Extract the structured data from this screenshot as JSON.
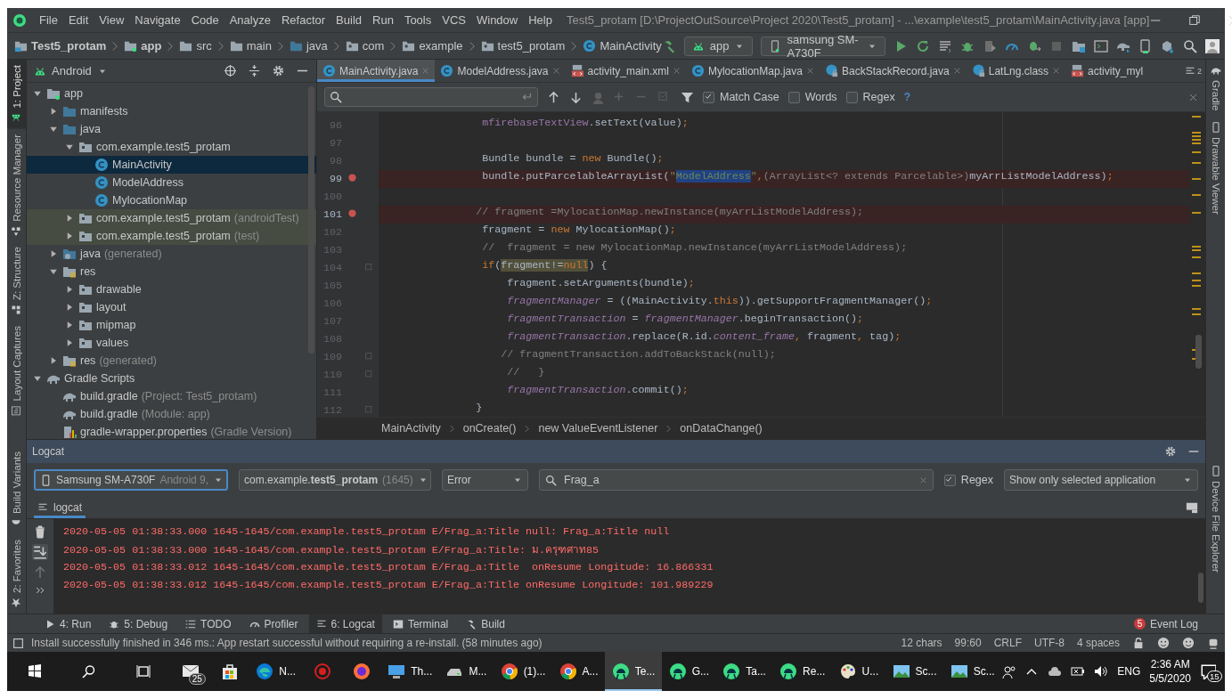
{
  "window": {
    "title": "Test5_protam [D:\\ProjectOutSource\\Project 2020\\Test5_protam] - ...\\example\\test5_protam\\MainActivity.java [app]",
    "menu": [
      "File",
      "Edit",
      "View",
      "Navigate",
      "Code",
      "Analyze",
      "Refactor",
      "Build",
      "Run",
      "Tools",
      "VCS",
      "Window",
      "Help"
    ]
  },
  "navigation": {
    "breadcrumbs": [
      {
        "label": "Test5_protam",
        "kind": "project"
      },
      {
        "label": "app",
        "kind": "module"
      },
      {
        "label": "src",
        "kind": "folder"
      },
      {
        "label": "main",
        "kind": "folder"
      },
      {
        "label": "java",
        "kind": "source"
      },
      {
        "label": "com",
        "kind": "package"
      },
      {
        "label": "example",
        "kind": "package"
      },
      {
        "label": "test5_protam",
        "kind": "package"
      },
      {
        "label": "MainActivity",
        "kind": "class"
      }
    ],
    "run_config": "app",
    "device": "samsung SM-A730F"
  },
  "left_stripe": [
    {
      "label": "1: Project",
      "selected": true
    },
    {
      "label": "Resource Manager",
      "selected": false
    },
    {
      "label": "Z: Structure",
      "selected": false
    },
    {
      "label": "Layout Captures",
      "selected": false
    },
    {
      "label": "Build Variants",
      "selected": false
    },
    {
      "label": "2: Favorites",
      "selected": false
    }
  ],
  "right_stripe": [
    "Gradle",
    "Drawable Viewer",
    "Device File Explorer"
  ],
  "project": {
    "view": "Android",
    "tree": [
      {
        "label": "app",
        "kind": "module",
        "expanded": true,
        "selected": false,
        "highlighted": false,
        "children": [
          {
            "label": "manifests",
            "kind": "source",
            "expanded": false,
            "selected": false,
            "highlighted": false
          },
          {
            "label": "java",
            "kind": "source",
            "expanded": true,
            "selected": false,
            "highlighted": false,
            "children": [
              {
                "label": "com.example.test5_protam",
                "kind": "package",
                "expanded": true,
                "selected": false,
                "highlighted": false,
                "children": [
                  {
                    "label": "MainActivity",
                    "kind": "class",
                    "selected": true,
                    "highlighted": false
                  },
                  {
                    "label": "ModelAddress",
                    "kind": "class",
                    "selected": false,
                    "highlighted": false
                  },
                  {
                    "label": "MylocationMap",
                    "kind": "class",
                    "selected": false,
                    "highlighted": false
                  }
                ]
              },
              {
                "label": "com.example.test5_protam",
                "note": "(androidTest)",
                "kind": "package",
                "expanded": false,
                "selected": false,
                "highlighted": true
              },
              {
                "label": "com.example.test5_protam",
                "note": "(test)",
                "kind": "package",
                "expanded": false,
                "selected": false,
                "highlighted": true
              }
            ]
          },
          {
            "label": "java",
            "note": "(generated)",
            "kind": "generated",
            "expanded": false,
            "selected": false,
            "highlighted": false
          },
          {
            "label": "res",
            "kind": "resources",
            "expanded": true,
            "selected": false,
            "highlighted": false,
            "children": [
              {
                "label": "drawable",
                "kind": "package",
                "expanded": false,
                "selected": false,
                "highlighted": false
              },
              {
                "label": "layout",
                "kind": "package",
                "expanded": false,
                "selected": false,
                "highlighted": false
              },
              {
                "label": "mipmap",
                "kind": "package",
                "expanded": false,
                "selected": false,
                "highlighted": false
              },
              {
                "label": "values",
                "kind": "package",
                "expanded": false,
                "selected": false,
                "highlighted": false
              }
            ]
          },
          {
            "label": "res",
            "note": "(generated)",
            "kind": "resources",
            "expanded": false,
            "selected": false,
            "highlighted": false
          }
        ]
      },
      {
        "label": "Gradle Scripts",
        "kind": "gradle",
        "expanded": true,
        "selected": false,
        "highlighted": false,
        "children": [
          {
            "label": "build.gradle",
            "note": "(Project: Test5_protam)",
            "kind": "gradle",
            "selected": false,
            "highlighted": false
          },
          {
            "label": "build.gradle",
            "note": "(Module: app)",
            "kind": "gradle",
            "selected": false,
            "highlighted": false
          },
          {
            "label": "gradle-wrapper.properties",
            "note": "(Gradle Version)",
            "kind": "properties",
            "selected": false,
            "highlighted": false
          }
        ]
      }
    ]
  },
  "editor": {
    "tabs": [
      {
        "label": "MainActivity.java",
        "kind": "class",
        "selected": true,
        "closable": true
      },
      {
        "label": "ModelAddress.java",
        "kind": "class",
        "selected": false,
        "closable": true
      },
      {
        "label": "activity_main.xml",
        "kind": "layout",
        "selected": false,
        "closable": true
      },
      {
        "label": "MylocationMap.java",
        "kind": "class",
        "selected": false,
        "closable": true
      },
      {
        "label": "BackStackRecord.java",
        "kind": "library",
        "selected": false,
        "closable": true
      },
      {
        "label": "LatLng.class",
        "kind": "library",
        "selected": false,
        "closable": true
      },
      {
        "label": "activity_myl",
        "kind": "layout",
        "selected": false,
        "closable": false
      }
    ],
    "tab_overflow": "2",
    "find": {
      "options": [
        {
          "label": "Match Case",
          "checked": true
        },
        {
          "label": "Words",
          "checked": false
        },
        {
          "label": "Regex",
          "checked": false
        }
      ],
      "help": "?"
    },
    "lines": [
      {
        "number": "96",
        "breakpoint": false,
        "fold": false,
        "segments": [
          {
            "kind": "field",
            "text": "                mfirebaseTextView"
          },
          {
            "kind": "plain",
            "text": ".setText(value)"
          },
          {
            "kind": "keyword",
            "text": ";"
          }
        ]
      },
      {
        "number": "97",
        "breakpoint": false,
        "fold": false
      },
      {
        "number": "98",
        "breakpoint": false,
        "fold": false,
        "segments": [
          {
            "kind": "plain",
            "text": "                Bundle bundle = "
          },
          {
            "kind": "keyword",
            "text": "new"
          },
          {
            "kind": "plain",
            "text": " Bundle()"
          },
          {
            "kind": "keyword",
            "text": ";"
          }
        ]
      },
      {
        "number": "99",
        "breakpoint": true,
        "fold": false,
        "segments": [
          {
            "kind": "plain",
            "text": "                bundle.putParcelableArrayList("
          },
          {
            "kind": "string",
            "text": "\""
          },
          {
            "kind": "selection",
            "text": "ModelAddress"
          },
          {
            "kind": "string",
            "text": "\""
          },
          {
            "kind": "keyword",
            "text": ","
          },
          {
            "kind": "redundant",
            "text": "(ArrayList<? extends Parcelable>)"
          },
          {
            "kind": "plain",
            "text": "myArrListModelAddress)"
          },
          {
            "kind": "keyword",
            "text": ";"
          }
        ]
      },
      {
        "number": "100",
        "breakpoint": false,
        "fold": false
      },
      {
        "number": "101",
        "breakpoint": true,
        "fold": false,
        "segments": [
          {
            "kind": "comment",
            "text": "               // fragment =MylocationMap.newInstance(myArrListModelAddress);"
          }
        ]
      },
      {
        "number": "102",
        "breakpoint": false,
        "fold": false,
        "segments": [
          {
            "kind": "plain",
            "text": "                fragment = "
          },
          {
            "kind": "keyword",
            "text": "new"
          },
          {
            "kind": "plain",
            "text": " MylocationMap()"
          },
          {
            "kind": "keyword",
            "text": ";"
          }
        ]
      },
      {
        "number": "103",
        "breakpoint": false,
        "fold": false,
        "segments": [
          {
            "kind": "comment",
            "text": "                //  fragment = new MylocationMap.newInstance(myArrListModelAddress);"
          }
        ]
      },
      {
        "number": "104",
        "breakpoint": false,
        "fold": true,
        "segments": [
          {
            "kind": "keyword",
            "text": "                if"
          },
          {
            "kind": "plain",
            "text": "("
          },
          {
            "kind": "match",
            "text": "fragment!="
          },
          {
            "kind": "match-keyword",
            "text": "null"
          },
          {
            "kind": "plain",
            "text": ") {"
          }
        ]
      },
      {
        "number": "105",
        "breakpoint": false,
        "fold": false,
        "segments": [
          {
            "kind": "plain",
            "text": "                    fragment.setArguments(bundle)"
          },
          {
            "kind": "keyword",
            "text": ";"
          }
        ]
      },
      {
        "number": "106",
        "breakpoint": false,
        "fold": false,
        "segments": [
          {
            "kind": "static-field",
            "text": "                    fragmentManager"
          },
          {
            "kind": "plain",
            "text": " = ((MainActivity."
          },
          {
            "kind": "keyword",
            "text": "this"
          },
          {
            "kind": "plain",
            "text": ")).getSupportFragmentManager()"
          },
          {
            "kind": "keyword",
            "text": ";"
          }
        ]
      },
      {
        "number": "107",
        "breakpoint": false,
        "fold": false,
        "segments": [
          {
            "kind": "static-field",
            "text": "                    fragmentTransaction"
          },
          {
            "kind": "plain",
            "text": " = "
          },
          {
            "kind": "static-field",
            "text": "fragmentManager"
          },
          {
            "kind": "plain",
            "text": ".beginTransaction()"
          },
          {
            "kind": "keyword",
            "text": ";"
          }
        ]
      },
      {
        "number": "108",
        "breakpoint": false,
        "fold": false,
        "segments": [
          {
            "kind": "static-field",
            "text": "                    fragmentTransaction"
          },
          {
            "kind": "plain",
            "text": ".replace(R.id."
          },
          {
            "kind": "static-field",
            "text": "content_frame"
          },
          {
            "kind": "keyword",
            "text": ","
          },
          {
            "kind": "plain",
            "text": " fragment"
          },
          {
            "kind": "keyword",
            "text": ","
          },
          {
            "kind": "plain",
            "text": " tag)"
          },
          {
            "kind": "keyword",
            "text": ";"
          }
        ]
      },
      {
        "number": "109",
        "breakpoint": false,
        "fold": true,
        "segments": [
          {
            "kind": "comment",
            "text": "                   // fragmentTransaction.addToBackStack(null);"
          }
        ]
      },
      {
        "number": "110",
        "breakpoint": false,
        "fold": true,
        "segments": [
          {
            "kind": "comment",
            "text": "                    //   }"
          }
        ]
      },
      {
        "number": "111",
        "breakpoint": false,
        "fold": false,
        "segments": [
          {
            "kind": "static-field",
            "text": "                    fragmentTransaction"
          },
          {
            "kind": "plain",
            "text": ".commit()"
          },
          {
            "kind": "keyword",
            "text": ";"
          }
        ]
      },
      {
        "number": "112",
        "breakpoint": false,
        "fold": true,
        "segments": [
          {
            "kind": "plain",
            "text": "               }"
          }
        ]
      }
    ],
    "breadcrumbs": [
      "MainActivity",
      "onCreate()",
      "new ValueEventListener",
      "onDataChange()"
    ]
  },
  "logcat": {
    "title": "Logcat",
    "device": {
      "name": "Samsung SM-A730F",
      "detail": "Android 9,"
    },
    "process": {
      "name": "com.example.**test5_protam**",
      "pid": "(1645)"
    },
    "level": "Error",
    "search": "Frag_a",
    "regex": {
      "label": "Regex",
      "checked": true
    },
    "filter": "Show only selected application",
    "tab": "logcat",
    "lines": [
      "2020-05-05 01:38:33.000 1645-1645/com.example.test5_protam E/Frag_a:Title null: Frag_a:Title null",
      "2020-05-05 01:38:33.000 1645-1645/com.example.test5_protam E/Frag_a:Title: ม.ครุฑศาท85",
      "2020-05-05 01:38:33.012 1645-1645/com.example.test5_protam E/Frag_a:Title  onResume Longitude: 16.866331",
      "2020-05-05 01:38:33.012 1645-1645/com.example.test5_protam E/Frag_a:Title onResume Longitude: 101.989229"
    ]
  },
  "tool_tabs": [
    {
      "label": "4: Run",
      "selected": false
    },
    {
      "label": "5: Debug",
      "selected": false
    },
    {
      "label": "TODO",
      "selected": false
    },
    {
      "label": "Profiler",
      "selected": false
    },
    {
      "label": "6: Logcat",
      "selected": true
    },
    {
      "label": "Terminal",
      "selected": false
    },
    {
      "label": "Build",
      "selected": false
    }
  ],
  "event_log": {
    "label": "Event Log",
    "count": "5"
  },
  "status_bar": {
    "message": "Install successfully finished in 346 ms.: App restart successful without requiring a re-install. (58 minutes ago)",
    "items": [
      "12 chars",
      "99:60",
      "CRLF",
      "UTF-8",
      "4 spaces"
    ]
  },
  "taskbar": {
    "apps": [
      {
        "kind": "mail",
        "badge": "25",
        "selected": false
      },
      {
        "kind": "store",
        "selected": false
      },
      {
        "kind": "edge",
        "label": "N...",
        "selected": false
      },
      {
        "kind": "red",
        "selected": false
      },
      {
        "kind": "firefox",
        "selected": false
      },
      {
        "kind": "computer",
        "label": "Th...",
        "selected": false
      },
      {
        "kind": "drive",
        "label": "M...",
        "selected": false
      },
      {
        "kind": "chrome",
        "label": "(1)...",
        "selected": false
      },
      {
        "kind": "chrome",
        "label": "A...",
        "selected": false
      },
      {
        "kind": "studio",
        "label": "Te...",
        "selected": true
      },
      {
        "kind": "studio",
        "label": "G...",
        "selected": false
      },
      {
        "kind": "studio",
        "label": "Ta...",
        "selected": false
      },
      {
        "kind": "studio",
        "label": "Re...",
        "selected": false
      },
      {
        "kind": "paint",
        "label": "U...",
        "selected": false
      },
      {
        "kind": "image",
        "label": "Sc...",
        "selected": false
      },
      {
        "kind": "image",
        "label": "Sc...",
        "selected": false
      }
    ],
    "language": "ENG",
    "time": "2:36 AM",
    "date": "5/5/2020",
    "notifications": "15"
  }
}
